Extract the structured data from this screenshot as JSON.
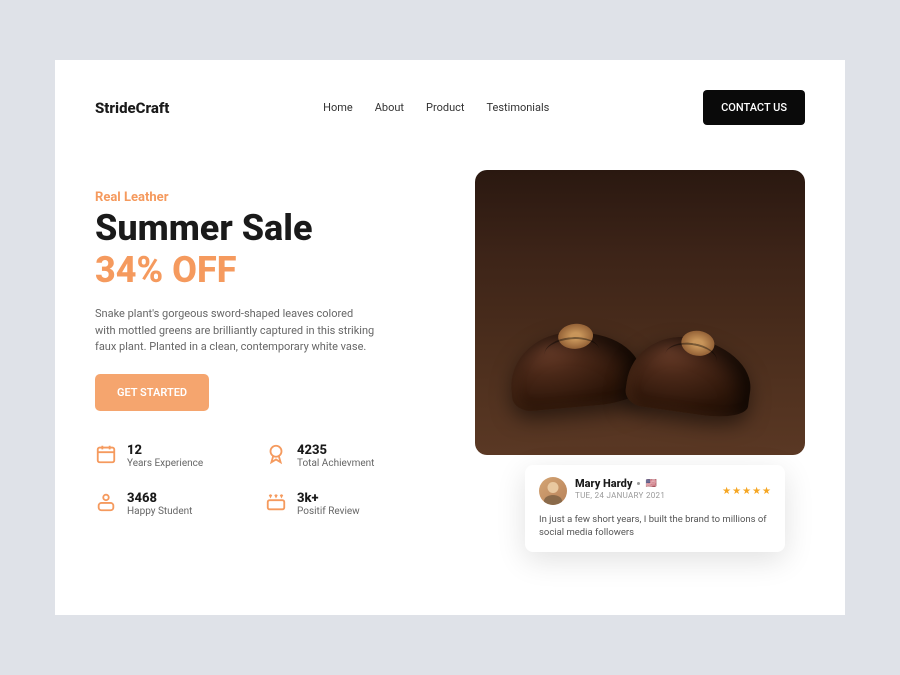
{
  "brand": "StrideCraft",
  "nav": [
    "Home",
    "About",
    "Product",
    "Testimonials"
  ],
  "contact_btn": "CONTACT US",
  "hero": {
    "eyebrow": "Real Leather",
    "title": "Summer Sale",
    "discount": "34% OFF",
    "description": "Snake plant's gorgeous sword-shaped leaves colored with mottled greens are brilliantly captured in this striking faux plant. Planted in a clean, contemporary white vase.",
    "cta": "GET STARTED"
  },
  "stats": [
    {
      "value": "12",
      "label": "Years Experience"
    },
    {
      "value": "4235",
      "label": "Total Achievment"
    },
    {
      "value": "3468",
      "label": "Happy Student"
    },
    {
      "value": "3k+",
      "label": "Positif Review"
    }
  ],
  "testimonial": {
    "name": "Mary Hardy",
    "flag": "🇺🇸",
    "date": "TUE, 24 JANUARY 2021",
    "text": "In just a few short years, I built the brand to millions of social media followers"
  },
  "colors": {
    "accent": "#f59a5e"
  }
}
